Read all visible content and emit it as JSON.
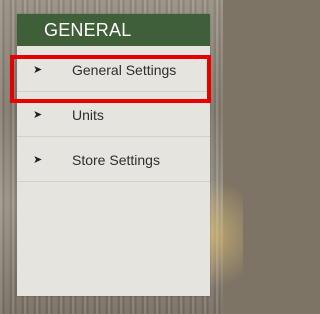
{
  "menu": {
    "header": "GENERAL",
    "items": [
      {
        "label": "General Settings",
        "icon": "chevron-right-icon"
      },
      {
        "label": "Units",
        "icon": "chevron-right-icon"
      },
      {
        "label": "Store Settings",
        "icon": "chevron-right-icon"
      }
    ],
    "highlighted_index": 0
  },
  "colors": {
    "header_bg": "#3f5f38",
    "menu_bg": "#e6e4df",
    "highlight": "#e60000",
    "background": "#857c70"
  }
}
